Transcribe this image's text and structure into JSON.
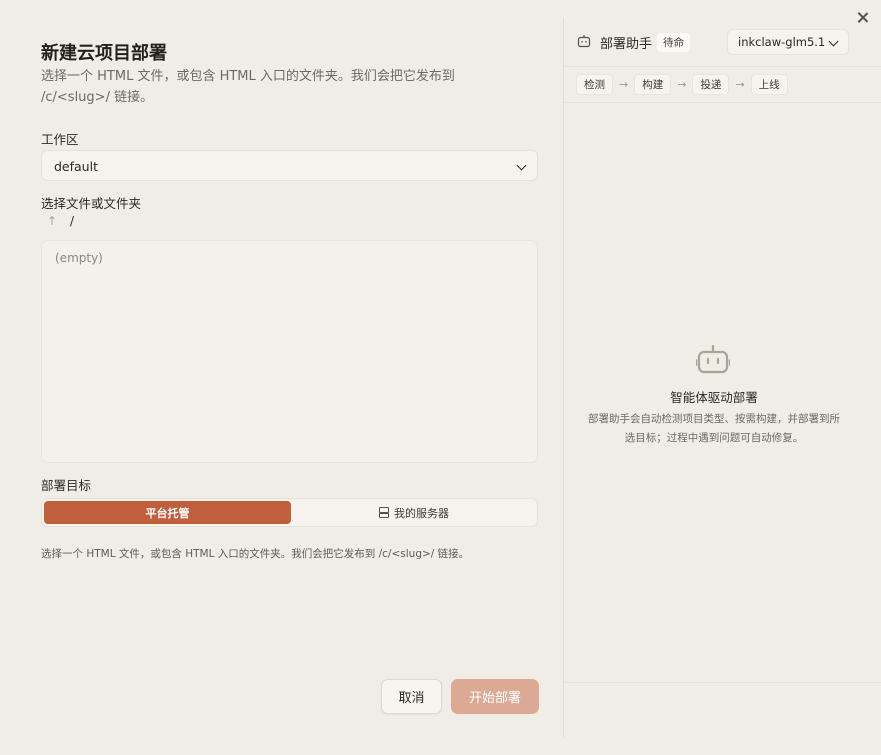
{
  "dialog": {
    "title": "新建云项目部署",
    "subtitle": "选择一个 HTML 文件，或包含 HTML 入口的文件夹。我们会把它发布到 /c/<slug>/ 链接。"
  },
  "workspace": {
    "label": "工作区",
    "value": "default"
  },
  "file_picker": {
    "label": "选择文件或文件夹",
    "up_icon": "arrow-up-icon",
    "up_glyph": "↑",
    "path": "/",
    "empty_text": "(empty)"
  },
  "target": {
    "label": "部署目标",
    "options": [
      "平台托管",
      "我的服务器"
    ],
    "selected": "平台托管",
    "hint": "选择一个 HTML 文件，或包含 HTML 入口的文件夹。我们会把它发布到 /c/<slug>/ 链接。"
  },
  "actions": {
    "cancel": "取消",
    "deploy": "开始部署"
  },
  "assistant": {
    "title": "部署助手",
    "status": "待命",
    "model": "inkclaw-glm5.1",
    "steps": [
      "检测",
      "构建",
      "投递",
      "上线"
    ],
    "step_arrow": "→",
    "empty_title": "智能体驱动部署",
    "empty_desc": "部署助手会自动检测项目类型、按需构建，并部署到所选目标；过程中遇到问题可自动修复。"
  },
  "colors": {
    "accent": "#c15f3c",
    "accent_disabled": "#dba994",
    "background": "#f0ede6"
  }
}
